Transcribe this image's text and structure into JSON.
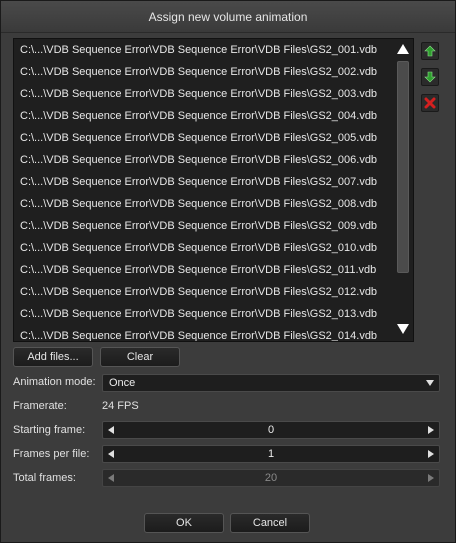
{
  "dialog": {
    "title": "Assign new volume animation"
  },
  "file_list": {
    "items": [
      "C:\\...\\VDB Sequence Error\\VDB Sequence Error\\VDB Files\\GS2_001.vdb",
      "C:\\...\\VDB Sequence Error\\VDB Sequence Error\\VDB Files\\GS2_002.vdb",
      "C:\\...\\VDB Sequence Error\\VDB Sequence Error\\VDB Files\\GS2_003.vdb",
      "C:\\...\\VDB Sequence Error\\VDB Sequence Error\\VDB Files\\GS2_004.vdb",
      "C:\\...\\VDB Sequence Error\\VDB Sequence Error\\VDB Files\\GS2_005.vdb",
      "C:\\...\\VDB Sequence Error\\VDB Sequence Error\\VDB Files\\GS2_006.vdb",
      "C:\\...\\VDB Sequence Error\\VDB Sequence Error\\VDB Files\\GS2_007.vdb",
      "C:\\...\\VDB Sequence Error\\VDB Sequence Error\\VDB Files\\GS2_008.vdb",
      "C:\\...\\VDB Sequence Error\\VDB Sequence Error\\VDB Files\\GS2_009.vdb",
      "C:\\...\\VDB Sequence Error\\VDB Sequence Error\\VDB Files\\GS2_010.vdb",
      "C:\\...\\VDB Sequence Error\\VDB Sequence Error\\VDB Files\\GS2_011.vdb",
      "C:\\...\\VDB Sequence Error\\VDB Sequence Error\\VDB Files\\GS2_012.vdb",
      "C:\\...\\VDB Sequence Error\\VDB Sequence Error\\VDB Files\\GS2_013.vdb",
      "C:\\...\\VDB Sequence Error\\VDB Sequence Error\\VDB Files\\GS2_014.vdb"
    ]
  },
  "side_buttons": {
    "move_up_icon": "arrow-up-icon",
    "move_down_icon": "arrow-down-icon",
    "remove_icon": "red-x-icon",
    "green_color": "#2e9e2e",
    "red_color": "#d42020"
  },
  "actions": {
    "add_files_label": "Add files...",
    "clear_label": "Clear"
  },
  "settings": {
    "animation_mode_label": "Animation mode:",
    "animation_mode_value": "Once",
    "framerate_label": "Framerate:",
    "framerate_value": "24 FPS",
    "starting_frame_label": "Starting frame:",
    "starting_frame_value": "0",
    "frames_per_file_label": "Frames per file:",
    "frames_per_file_value": "1",
    "total_frames_label": "Total frames:",
    "total_frames_value": "20"
  },
  "footer": {
    "ok_label": "OK",
    "cancel_label": "Cancel"
  }
}
